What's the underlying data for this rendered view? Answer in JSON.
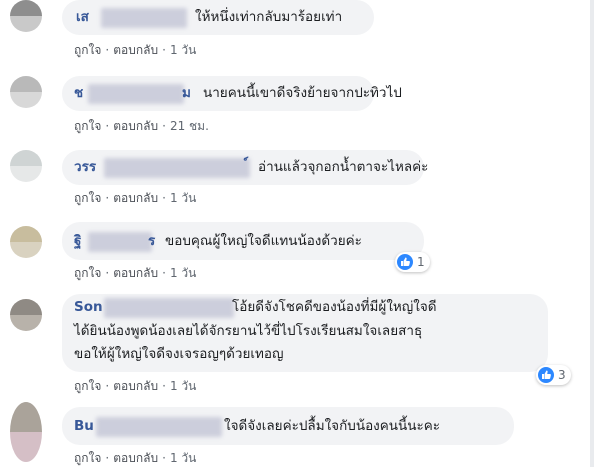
{
  "comments": [
    {
      "name_prefix": "เส",
      "text_lines": [
        "ให้หนึ่งเท่ากลับมาร้อยเท่า"
      ],
      "actions": {
        "like": "ถูกใจ",
        "reply": "ตอบกลับ",
        "time": "1 วัน"
      },
      "avatar_colors": [
        "#8e8e8e",
        "#c9c9c9"
      ]
    },
    {
      "name_prefix": "ช",
      "name_suffix": "ม",
      "text_lines": [
        "นายคนนี้เขาดีจริงย้ายจากปะทิวไป"
      ],
      "actions": {
        "like": "ถูกใจ",
        "reply": "ตอบกลับ",
        "time": "21 ชม."
      },
      "avatar_colors": [
        "#b9b9b9",
        "#d8d8d8"
      ]
    },
    {
      "name_prefix": "วรร",
      "name_suffix": "์",
      "text_lines": [
        "อ่านแล้วจุกอกน้ำตาจะไหลค่ะ"
      ],
      "actions": {
        "like": "ถูกใจ",
        "reply": "ตอบกลับ",
        "time": "1 วัน"
      },
      "avatar_colors": [
        "#cfd4d4",
        "#e6e8e8"
      ]
    },
    {
      "name_prefix": "ฐิ",
      "name_suffix": "ร",
      "text_lines": [
        "ขอบคุณผู้ใหญ่ใจดีแทนน้องด้วยค่ะ"
      ],
      "actions": {
        "like": "ถูกใจ",
        "reply": "ตอบกลับ",
        "time": "1 วัน"
      },
      "reaction_count": "1",
      "avatar_colors": [
        "#c8bd9e",
        "#d9d2c0"
      ]
    },
    {
      "name_prefix": "Son",
      "text_lines": [
        "โอ้ยดีจังโชคดีของน้องที่มีผู้ใหญ่ใจดี",
        "ได้ยินน้องพูดน้องเลยได้จักรยานไว้ขี่ไปโรงเรียนสมใจเลยสาธุ",
        "ขอให้ผู้ใหญ่ใจดีจงเจรอญๆด้วยเทอญ"
      ],
      "actions": {
        "like": "ถูกใจ",
        "reply": "ตอบกลับ",
        "time": "1 วัน"
      },
      "reaction_count": "3",
      "avatar_colors": [
        "#8f8a84",
        "#b8b2aa"
      ]
    },
    {
      "name_prefix": "Bu",
      "text_lines": [
        "ใจดีจังเลยค่ะปลื้มใจกับน้องคนนี้นะคะ"
      ],
      "actions": {
        "like": "ถูกใจ",
        "reply": "ตอบกลับ",
        "time": "1 วัน"
      },
      "avatar_colors": [
        "#aaa39a",
        "#d5bfc6"
      ]
    }
  ],
  "colors": {
    "name_link": "#385898",
    "bubble_bg": "#f2f3f5",
    "like_blue": "#2d88ff"
  },
  "icons": {
    "reaction": "like-thumb-icon"
  }
}
